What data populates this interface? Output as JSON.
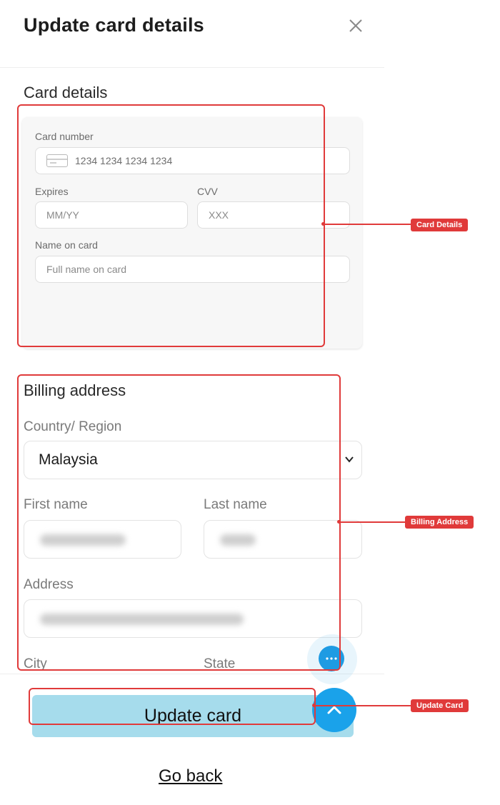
{
  "header": {
    "title": "Update card details",
    "close_icon": "close-icon"
  },
  "card_details": {
    "section_title": "Card details",
    "card_number": {
      "label": "Card number",
      "placeholder": "1234 1234 1234 1234",
      "icon": "credit-card-icon"
    },
    "expires": {
      "label": "Expires",
      "placeholder": "MM/YY"
    },
    "cvv": {
      "label": "CVV",
      "placeholder": "XXX"
    },
    "name_on_card": {
      "label": "Name on card",
      "placeholder": "Full name on card"
    }
  },
  "billing_address": {
    "section_title": "Billing address",
    "country": {
      "label": "Country/ Region",
      "value": "Malaysia"
    },
    "first_name": {
      "label": "First name"
    },
    "last_name": {
      "label": "Last name"
    },
    "address": {
      "label": "Address"
    },
    "city": {
      "label": "City"
    },
    "state": {
      "label": "State"
    }
  },
  "actions": {
    "update_label": "Update card",
    "go_back_label": "Go back"
  },
  "annotations": {
    "card_details": "Card Details",
    "billing_address": "Billing Address",
    "update_card": "Update Card"
  },
  "colors": {
    "update_button_bg": "#a6dcec",
    "fab_blue": "#1aa2ea",
    "annotation_red": "#e03a3a"
  }
}
